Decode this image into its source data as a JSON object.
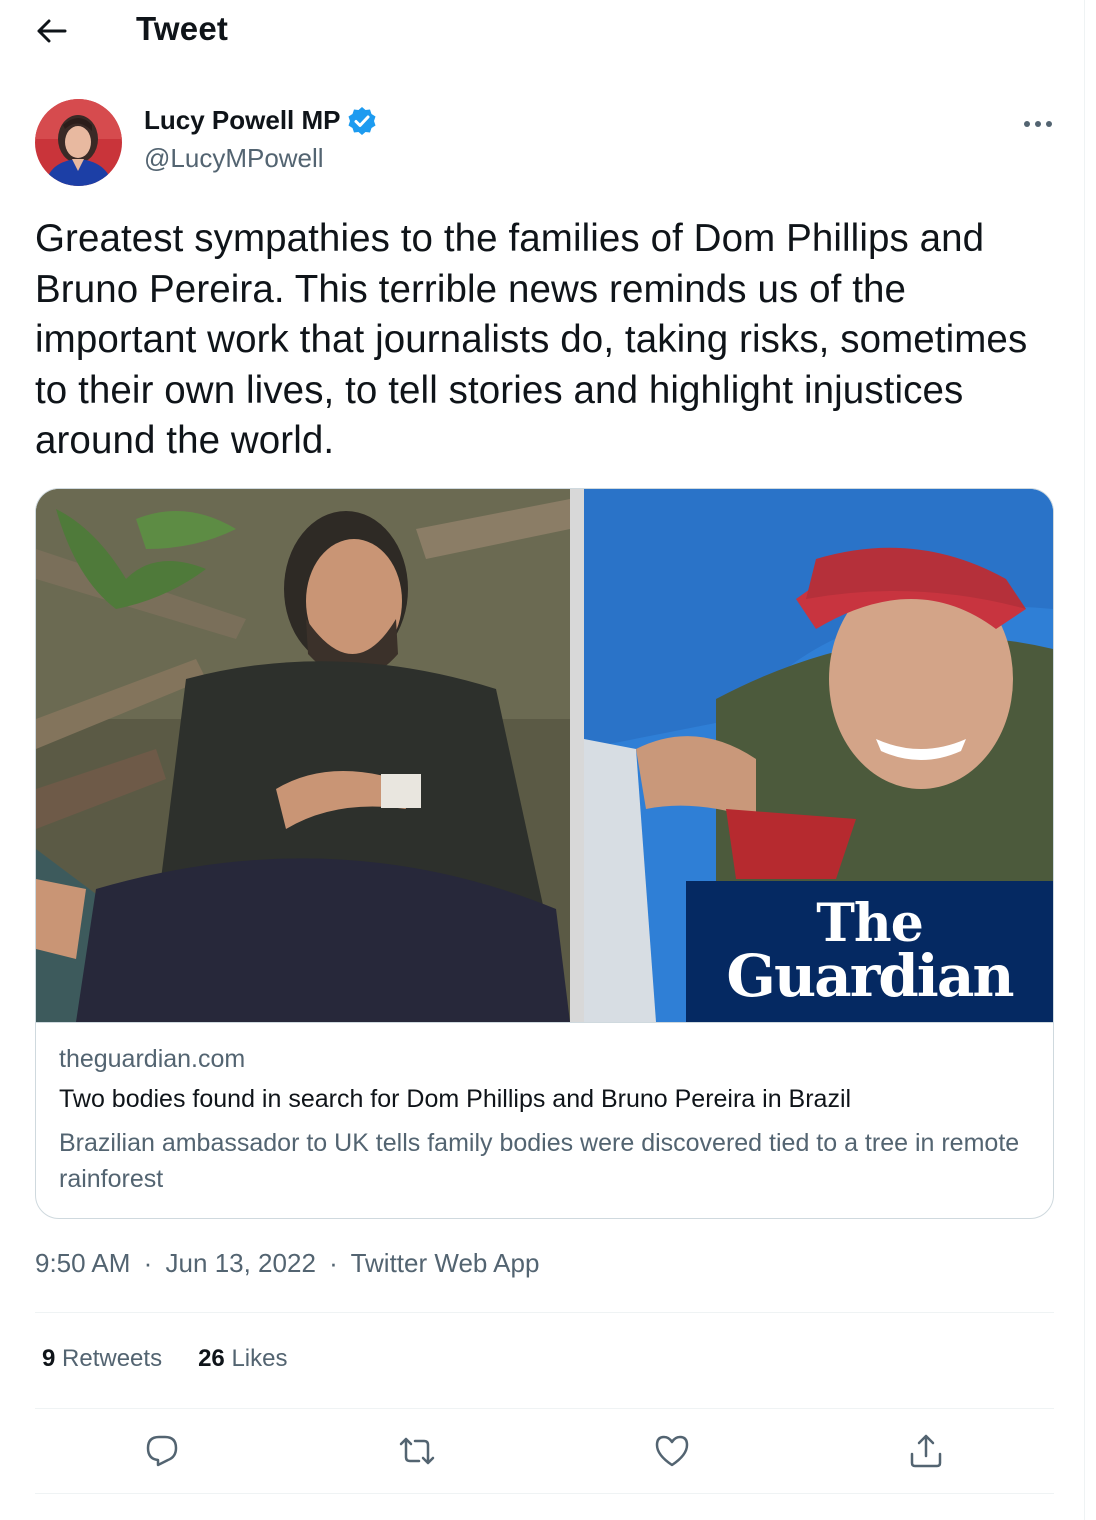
{
  "header": {
    "title": "Tweet",
    "back_icon": "arrow-left-icon"
  },
  "author": {
    "name": "Lucy Powell MP",
    "handle": "@LucyMPowell",
    "verified": true,
    "verified_color": "#1d9bf0"
  },
  "tweet": {
    "text": "Greatest sympathies to the families of Dom Phillips and Bruno Pereira. This terrible news reminds us of the important work that journalists do, taking risks, sometimes to their own lives, to tell stories and highlight injustices around the world."
  },
  "card": {
    "logo_line1": "The",
    "logo_line2": "Guardian",
    "logo_bg": "#052962",
    "domain": "theguardian.com",
    "title": "Two bodies found in search for Dom Phillips and Bruno Pereira in Brazil",
    "description": "Brazilian ambassador to UK tells family bodies were discovered tied to a tree in remote rainforest"
  },
  "meta": {
    "time": "9:50 AM",
    "date": "Jun 13, 2022",
    "source": "Twitter Web App",
    "separator": "·"
  },
  "stats": {
    "retweets_count": "9",
    "retweets_label": "Retweets",
    "likes_count": "26",
    "likes_label": "Likes"
  },
  "actions": [
    "reply-icon",
    "retweet-icon",
    "like-icon",
    "share-icon"
  ]
}
